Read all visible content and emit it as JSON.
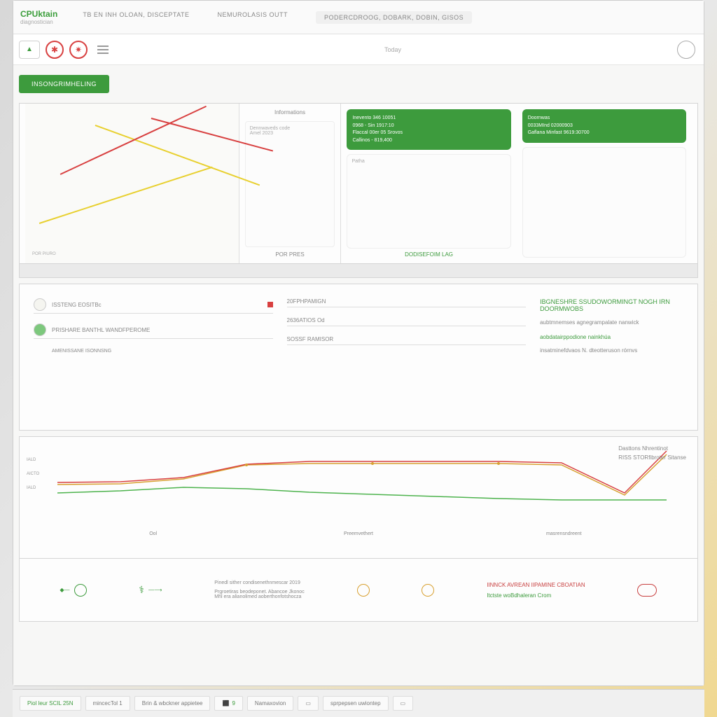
{
  "app": {
    "name": "CPUktain",
    "subtitle": "diagnostician"
  },
  "titlebar": {
    "tabs": [
      "TB EN INH OLOAN, DISCEPTATE",
      "NEMUROLASIS OUTT",
      "PODERCDROOG, DOBARK, DOBIN, GISOS"
    ]
  },
  "toolbar": {
    "center": "Today"
  },
  "buttons": {
    "primary": "INSONGRIMHELING"
  },
  "map_footer": [
    "",
    "",
    "",
    ""
  ],
  "cards": [
    {
      "header": "Informations",
      "footer": "POR PRES",
      "body_lines": [
        "Dennwaveds code",
        "Amel 2023"
      ]
    },
    {
      "box_lines": [
        "Inevento 346 10051",
        "0968 - Sin 1917:10",
        "Flaccal 00er 05 Srovos",
        "Callinos - 819,400"
      ],
      "lower": "Patha",
      "footer": "DODISEFOIM LAG"
    },
    {
      "box_lines": [
        "Doornwas",
        "0033MInd 02000903",
        "Gaflana Minfast 9619:30700"
      ],
      "footer": ""
    }
  ],
  "mid": {
    "left_fields": [
      {
        "label": "ISSTENG EOSITBc"
      },
      {
        "label": "PRISHARE BANTHL WANDFPEROME"
      },
      {
        "label": "AMENISSANE ISONNSNG"
      }
    ],
    "center_fields": [
      {
        "label": "20FPHPAMIGN"
      },
      {
        "label": "2636ATIOS Od"
      },
      {
        "label": "SOSSF RAMISOR"
      }
    ],
    "right": {
      "title": "IBGNESHRE SSUDOWORMINGT NOGH IRN DOORMWOBS",
      "line1": "aubtmnemses agnegrampalate nanwick",
      "line2": "aobdatairppodione nainkhúa",
      "line3": "insatminefdvaos N. dteotteruson rórnvs"
    }
  },
  "chart": {
    "legend": [
      {
        "label": "Dasttons Nhrentinot",
        "color": "#3d9b3d"
      },
      {
        "label": "RISS STORfibroter Sitanse",
        "color": "#d8a030"
      }
    ],
    "y_labels": [
      "IALD",
      "AICTO",
      "IALD"
    ],
    "x_labels": [
      "Ool",
      "Preemvethert",
      "masrensndreent"
    ]
  },
  "chart_data": {
    "type": "line",
    "x": [
      0,
      1,
      2,
      3,
      4,
      5,
      6,
      7,
      8,
      9,
      10
    ],
    "series": [
      {
        "name": "green",
        "color": "#4db34d",
        "values": [
          45,
          48,
          52,
          50,
          46,
          44,
          42,
          40,
          38,
          38,
          38
        ]
      },
      {
        "name": "orange",
        "color": "#d8a030",
        "values": [
          55,
          56,
          62,
          78,
          80,
          80,
          80,
          80,
          78,
          42,
          92
        ]
      },
      {
        "name": "red",
        "color": "#d84040",
        "values": [
          58,
          59,
          64,
          79,
          82,
          82,
          82,
          82,
          80,
          45,
          95
        ]
      }
    ],
    "ylim": [
      0,
      100
    ]
  },
  "icons": {
    "items": [
      {
        "label": "Pinedl sither condisenethnmescar 2019",
        "color": "#888"
      },
      {
        "sublabel": "Prgroetiras beodeponet. Abancoe Jkonoc",
        "subline2": "Mhl era alianolimed aoberthonfotshocza"
      },
      {
        "label": "IINNCK AVREAN IIPAMINE CBOATIAN",
        "color": "#c84040"
      },
      {
        "sublabel": "Itctste woBdhaleran Crom",
        "color": "#3d9b3d"
      }
    ]
  },
  "taskbar": {
    "items": [
      "Piol leur SCIL 25N",
      "mincecTol 1",
      "Brin & wbckner appietee",
      "9",
      "Namaxovion",
      "",
      "sprpepsen uwiontep",
      ""
    ]
  }
}
